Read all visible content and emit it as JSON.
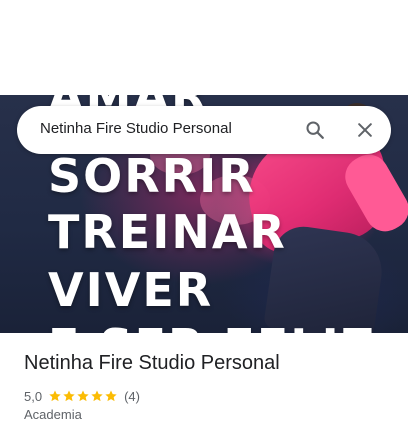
{
  "search": {
    "query": "Netinha Fire Studio Personal"
  },
  "hero": {
    "words": [
      "AMAR",
      "SORRIR",
      "TREINAR",
      "VIVER",
      "E SER FELIZ"
    ]
  },
  "place": {
    "name": "Netinha Fire Studio Personal",
    "rating_value": "5,0",
    "rating_stars": 5,
    "review_count": "(4)",
    "category": "Academia"
  },
  "colors": {
    "star": "#fbbc04",
    "accent_pink": "#e32c73"
  }
}
